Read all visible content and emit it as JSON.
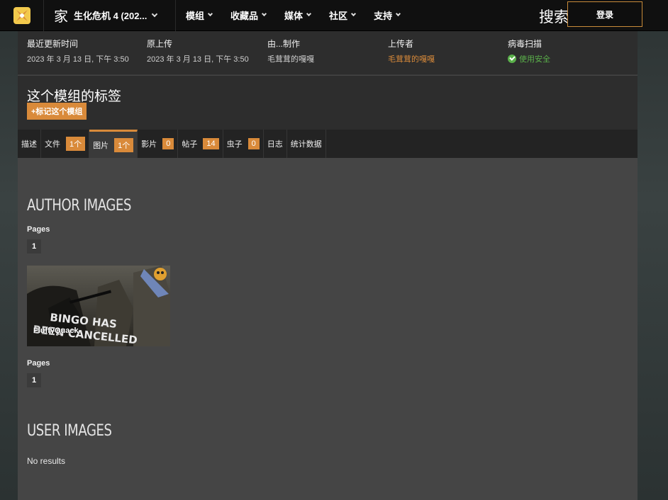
{
  "nav": {
    "game_home": "家",
    "game_name": "生化危机 4 (202...",
    "menu": [
      "模组",
      "收藏品",
      "媒体",
      "社区",
      "支持"
    ],
    "search_label": "搜索",
    "login": "登录"
  },
  "meta": {
    "last_updated_label": "最近更新时间",
    "last_updated_value": "2023 年 3 月 13 日, 下午 3:50",
    "original_upload_label": "原上传",
    "original_upload_value": "2023 年 3 月 13 日, 下午 3:50",
    "created_by_label": "由...制作",
    "created_by_value": "毛茸茸的嘎嘎",
    "uploaded_by_label": "上传者",
    "uploaded_by_value": "毛茸茸的嘎嘎",
    "virus_scan_label": "病毒扫描",
    "virus_scan_value": "使用安全"
  },
  "tags": {
    "title": "这个模组的标签",
    "button": "+标记这个模组"
  },
  "tabs": [
    {
      "label": "描述",
      "count": ""
    },
    {
      "label": "文件",
      "count": "1个"
    },
    {
      "label": "图片",
      "count": "1个"
    },
    {
      "label": "影片",
      "count": "0"
    },
    {
      "label": "帖子",
      "count": "14"
    },
    {
      "label": "虫子",
      "count": "0"
    },
    {
      "label": "日志",
      "count": ""
    },
    {
      "label": "统计数据",
      "count": ""
    }
  ],
  "author_images": {
    "title": "AUTHOR IMAGES",
    "pages_label": "Pages",
    "page": "1",
    "thumb_text_line1": "BINGO HAS",
    "thumb_text_line2": "BEEN CANCELLED",
    "thumb_author": "FluffyQuack"
  },
  "author_images_bottom": {
    "pages_label": "Pages",
    "page": "1"
  },
  "user_images": {
    "title": "USER IMAGES",
    "no_results": "No results"
  },
  "colors": {
    "accent": "#d98a3a",
    "safe": "#5ab04a"
  }
}
